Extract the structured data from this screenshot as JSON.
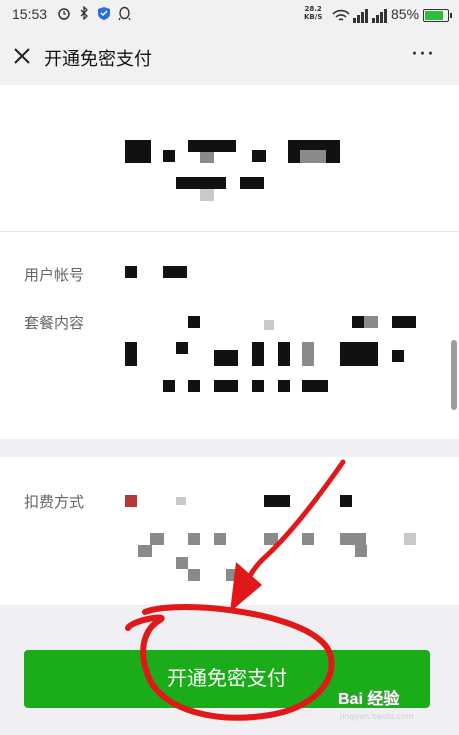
{
  "status_bar": {
    "time": "15:53",
    "net_speed": "28.2",
    "net_unit": "KB/S",
    "battery": "85%",
    "icons": [
      "alarm-icon",
      "bluetooth-icon",
      "shield-icon",
      "qq-icon",
      "wifi-icon",
      "signal-icon"
    ]
  },
  "nav": {
    "title": "开通免密支付",
    "close_icon": "close-icon",
    "more_icon": "more-icon"
  },
  "fields": {
    "account_label": "用户帐号",
    "plan_label": "套餐内容",
    "deduct_label": "扣费方式"
  },
  "button": {
    "label": "开通免密支付"
  },
  "colors": {
    "accent": "#1aad19",
    "annotation": "#e01818"
  },
  "watermark": {
    "text": "Bai 经验",
    "sub": "jingyan.baidu.com"
  }
}
